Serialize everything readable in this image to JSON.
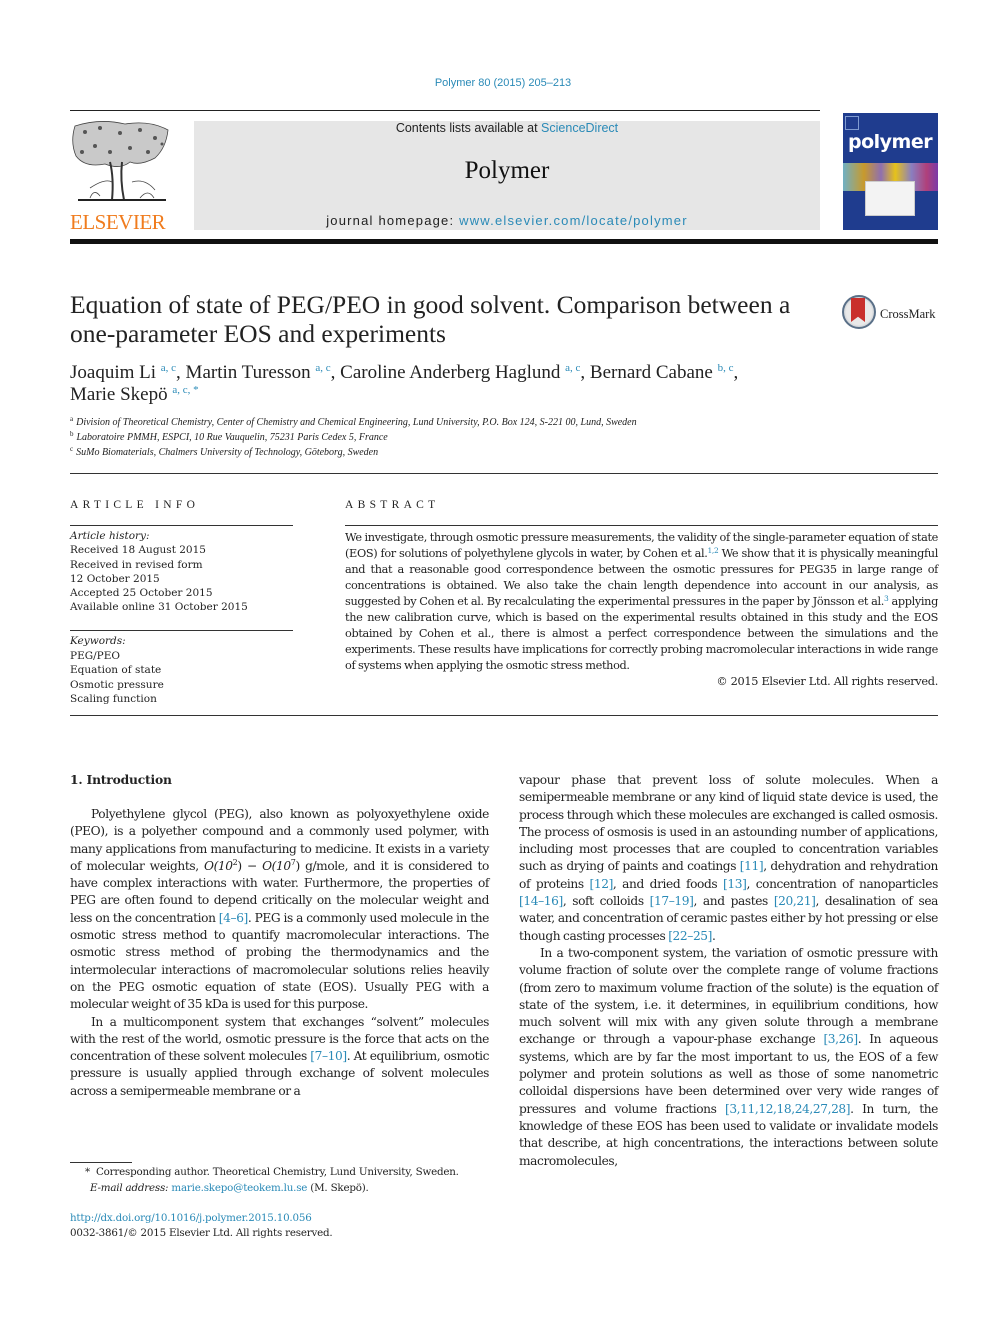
{
  "header": {
    "citation": "Polymer 80 (2015) 205–213",
    "contents_prefix": "Contents lists available at ",
    "contents_link": "ScienceDirect",
    "journal_name": "Polymer",
    "homepage_prefix": "journal homepage: ",
    "homepage_link": "www.elsevier.com/locate/polymer",
    "publisher_logo_text": "ELSEVIER",
    "cover_title": "polymer",
    "crossmark_label": "CrossMark"
  },
  "colors": {
    "link": "#2a8ab7",
    "elsevier_orange": "#f07c1e",
    "cover_blue": "#1f3c8e",
    "header_box": "#e6e6e6"
  },
  "article": {
    "title": "Equation of state of PEG/PEO in good solvent. Comparison between a one-parameter EOS and experiments",
    "authors": [
      {
        "name": "Joaquim Li",
        "aff": "a, c",
        "sep": ", "
      },
      {
        "name": "Martin Turesson",
        "aff": "a, c",
        "sep": ", "
      },
      {
        "name": "Caroline Anderberg Haglund",
        "aff": "a, c",
        "sep": ", "
      },
      {
        "name": "Bernard Cabane",
        "aff": "b, c",
        "sep": ","
      },
      {
        "name": "Marie Skepö",
        "aff": "a, c, *",
        "sep": ""
      }
    ],
    "affiliations": [
      {
        "key": "a",
        "text": "Division of Theoretical Chemistry, Center of Chemistry and Chemical Engineering, Lund University, P.O. Box 124, S-221 00, Lund, Sweden"
      },
      {
        "key": "b",
        "text": "Laboratoire PMMH, ESPCI, 10 Rue Vauquelin, 75231 Paris Cedex 5, France"
      },
      {
        "key": "c",
        "text": "SuMo Biomaterials, Chalmers University of Technology, Göteborg, Sweden"
      }
    ]
  },
  "article_info": {
    "heading": "ARTICLE INFO",
    "history_label": "Article history:",
    "history": [
      "Received 18 August 2015",
      "Received in revised form",
      "12 October 2015",
      "Accepted 25 October 2015",
      "Available online 31 October 2015"
    ],
    "keywords_label": "Keywords:",
    "keywords": [
      "PEG/PEO",
      "Equation of state",
      "Osmotic pressure",
      "Scaling function"
    ]
  },
  "abstract": {
    "heading": "ABSTRACT",
    "p1": "We investigate, through osmotic pressure measurements, the validity of the single-parameter equation of state (EOS) for solutions of polyethylene glycols in water, by Cohen et al.",
    "sup1": "1,2",
    "p2": " We show that it is physically meaningful and that a reasonable good correspondence between the osmotic pressures for PEG35 in large range of concentrations is obtained. We also take the chain length dependence into account in our analysis, as suggested by Cohen et al. By recalculating the experimental pressures in the paper by Jönsson et al.",
    "sup2": "3",
    "p3": " applying the new calibration curve, which is based on the experimental results obtained in this study and the EOS obtained by Cohen et al., there is almost a perfect correspondence between the simulations and the experiments. These results have implications for correctly probing macromolecular interactions in wide range of systems when applying the osmotic stress method.",
    "copyright": "© 2015 Elsevier Ltd. All rights reserved."
  },
  "body": {
    "section_heading": "1.  Introduction",
    "left_p1_a": "Polyethylene glycol (PEG), also known as polyoxyethylene oxide (PEO), is a polyether compound and a commonly used polymer, with many applications from manufacturing to medicine. It exists in a variety of molecular weights, ",
    "mw_low_base": "O(10",
    "mw_low_exp": "2",
    "mw_dash": ") − ",
    "mw_high_base": "O(10",
    "mw_high_exp": "7",
    "left_p1_b": ") g/mole, and it is considered to have complex interactions with water. Furthermore, the properties of PEG are often found to depend critically on the molecular weight and less on the concentration ",
    "ref_4_6": "[4–6]",
    "left_p1_c": ". PEG is a commonly used molecule in the osmotic stress method to quantify macromolecular interactions. The osmotic stress method of probing the thermodynamics and the intermolecular interactions of macromolecular solutions relies heavily on the PEG osmotic equation of state (EOS). Usually PEG with a molecular weight of 35 kDa is used for this purpose.",
    "left_p2_a": "In a multicomponent system that exchanges “solvent” molecules with the rest of the world, osmotic pressure is the force that acts on the concentration of these solvent molecules ",
    "ref_7_10": "[7–10]",
    "left_p2_b": ". At equilibrium, osmotic pressure is usually applied through exchange of solvent molecules across a semipermeable membrane or a",
    "right_p1_a": "vapour phase that prevent loss of solute molecules. When a semipermeable membrane or any kind of liquid state device is used, the process through which these molecules are exchanged is called osmosis. The process of osmosis is used in an astounding number of applications, including most processes that are coupled to concentration variables such as drying of paints and coatings ",
    "ref_11": "[11]",
    "right_p1_b": ", dehydration and rehydration of proteins ",
    "ref_12": "[12]",
    "right_p1_c": ", and dried foods ",
    "ref_13": "[13]",
    "right_p1_d": ", concentration of nanoparticles ",
    "ref_14_16": "[14–16]",
    "right_p1_e": ", soft colloids ",
    "ref_17_19": "[17–19]",
    "right_p1_f": ", and pastes ",
    "ref_20_21": "[20,21]",
    "right_p1_g": ", desalination of sea water, and concentration of ceramic pastes either by hot pressing or else though casting processes ",
    "ref_22_25": "[22–25]",
    "right_p1_h": ".",
    "right_p2_a": "In a two-component system, the variation of osmotic pressure with volume fraction of solute over the complete range of volume fractions (from zero to maximum volume fraction of the solute) is the equation of state of the system, i.e. it determines, in equilibrium conditions, how much solvent will mix with any given solute through a membrane exchange or through a vapour-phase exchange ",
    "ref_3_26": "[3,26]",
    "right_p2_b": ". In aqueous systems, which are by far the most important to us, the EOS of a few polymer and protein solutions as well as those of some nanometric colloidal dispersions have been determined over very wide ranges of pressures and volume fractions ",
    "ref_3_28": "[3,11,12,18,24,27,28]",
    "right_p2_c": ". In turn, the knowledge of these EOS has been used to validate or invalidate models that describe, at high concentrations, the interactions between solute macromolecules,"
  },
  "footnotes": {
    "star": "*",
    "corresponding": "Corresponding author. Theoretical Chemistry, Lund University, Sweden.",
    "email_label": "E-mail address: ",
    "email": "marie.skepo@teokem.lu.se",
    "email_suffix": " (M. Skepö).",
    "doi": "http://dx.doi.org/10.1016/j.polymer.2015.10.056",
    "issn": "0032-3861/© 2015 Elsevier Ltd. All rights reserved."
  }
}
